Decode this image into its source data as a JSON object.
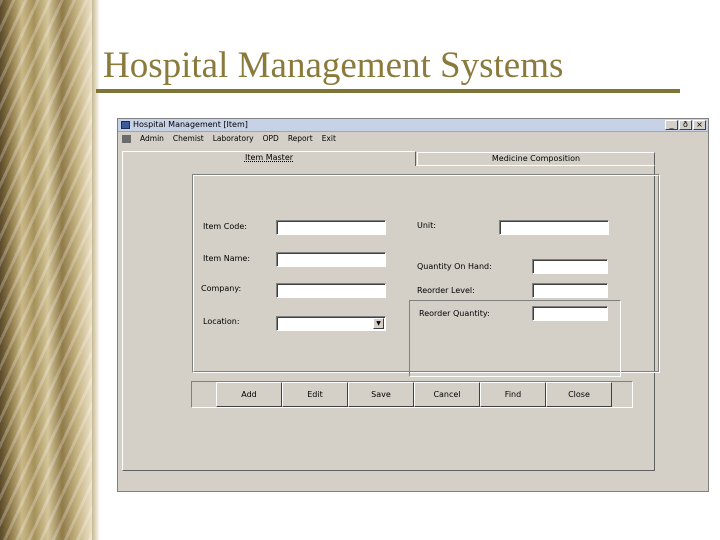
{
  "slide": {
    "title": "Hospital Management Systems"
  },
  "window": {
    "title": "Hospital Management   [Item]",
    "controls": {
      "minimize": "_",
      "maximize": "ð",
      "close": "×"
    }
  },
  "menu": {
    "items": [
      "Admin",
      "Chemist",
      "Laboratory",
      "OPD",
      "Report",
      "Exit"
    ]
  },
  "tabs": [
    {
      "label": "Item Master",
      "active": true
    },
    {
      "label": "Medicine Composition",
      "active": false
    }
  ],
  "form": {
    "item_code": {
      "label": "Item Code:",
      "value": ""
    },
    "item_name": {
      "label": "Item Name:",
      "value": ""
    },
    "company": {
      "label": "Company:",
      "value": ""
    },
    "location": {
      "label": "Location:",
      "value": ""
    },
    "unit": {
      "label": "Unit:",
      "value": ""
    },
    "quantity_on_hand": {
      "label": "Quantity On Hand:",
      "value": ""
    },
    "reorder_level": {
      "label": "Reorder Level:",
      "value": ""
    },
    "reorder_quantity": {
      "label": "Reorder Quantity:",
      "value": ""
    }
  },
  "buttons": [
    "Add",
    "Edit",
    "Save",
    "Cancel",
    "Find",
    "Close"
  ],
  "colors": {
    "title": "#8a7a3c",
    "rule": "#7d7436",
    "window_face": "#d4d0c8",
    "titlebar": "#c8d2e6"
  }
}
